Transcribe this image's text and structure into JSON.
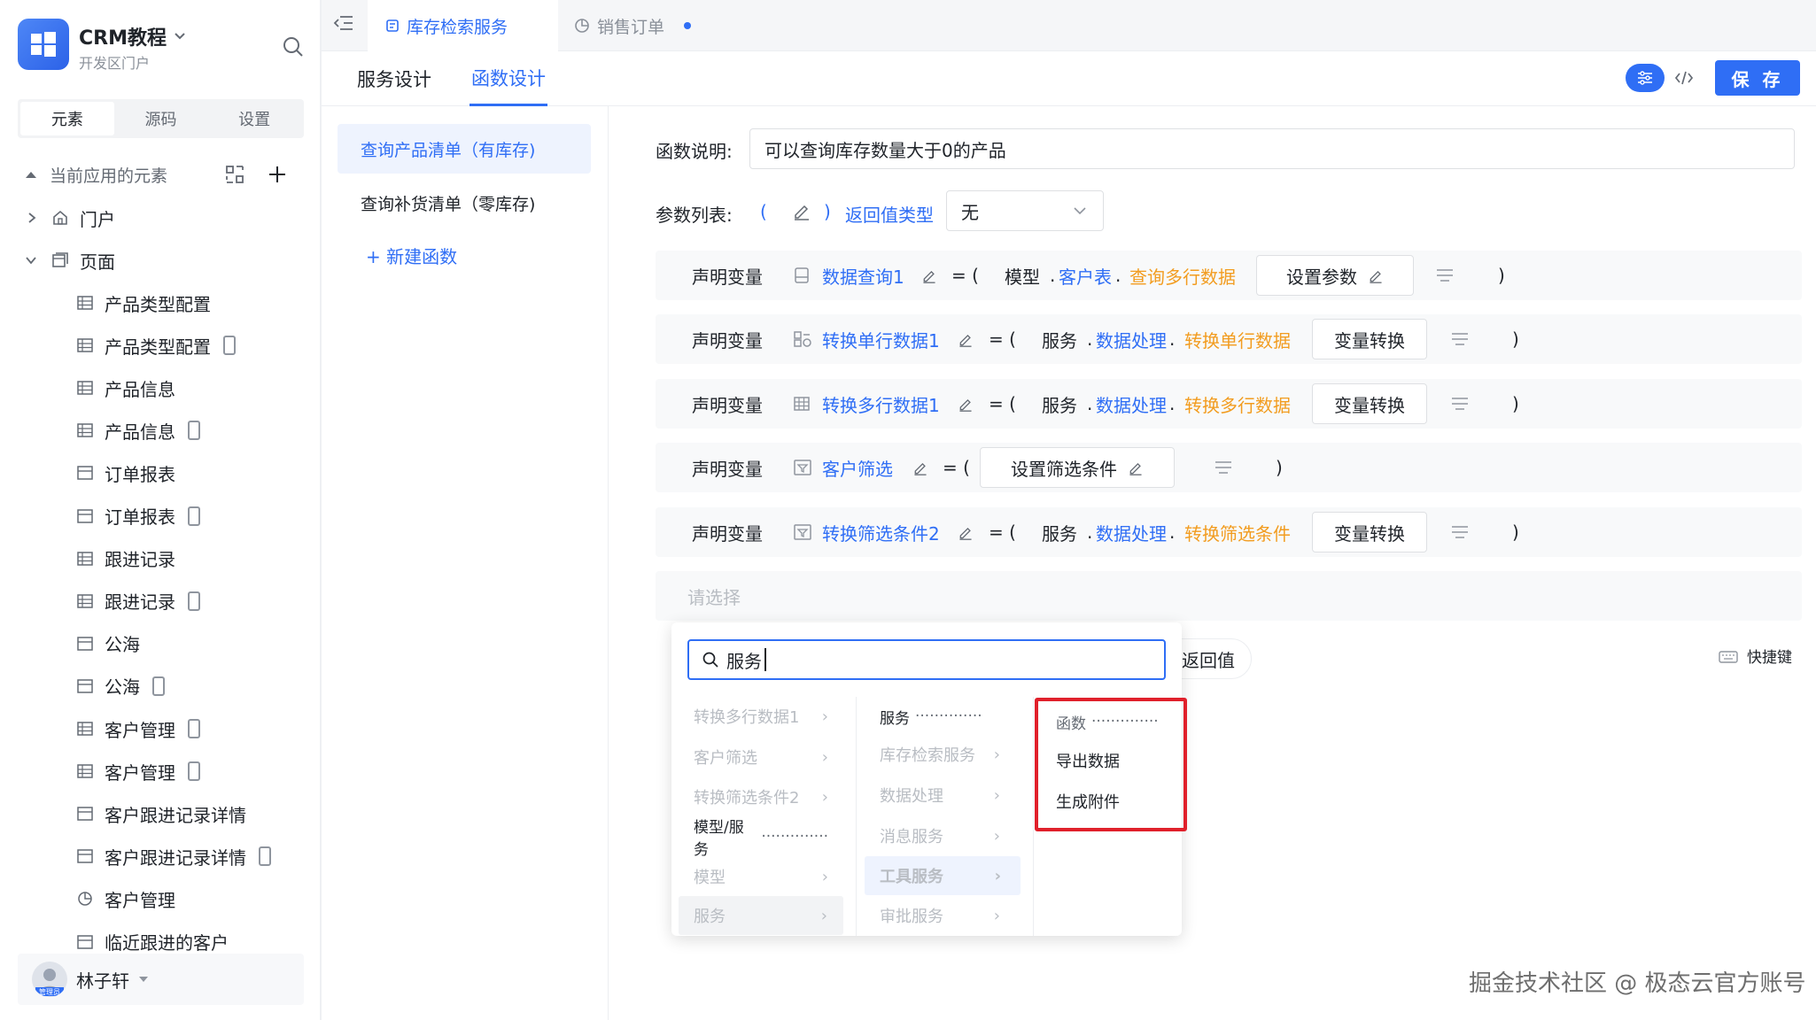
{
  "app": {
    "name": "CRM教程",
    "subtitle": "开发区门户"
  },
  "sidebar": {
    "tabs": [
      "元素",
      "源码",
      "设置"
    ],
    "section_title": "当前应用的元素",
    "nodes": [
      {
        "label": "门户"
      },
      {
        "label": "页面"
      }
    ],
    "pages": [
      {
        "label": "产品类型配置",
        "mobile": false,
        "icon": "table"
      },
      {
        "label": "产品类型配置",
        "mobile": true,
        "icon": "table"
      },
      {
        "label": "产品信息",
        "mobile": false,
        "icon": "table"
      },
      {
        "label": "产品信息",
        "mobile": true,
        "icon": "table"
      },
      {
        "label": "订单报表",
        "mobile": false,
        "icon": "card"
      },
      {
        "label": "订单报表",
        "mobile": true,
        "icon": "card"
      },
      {
        "label": "跟进记录",
        "mobile": false,
        "icon": "table"
      },
      {
        "label": "跟进记录",
        "mobile": true,
        "icon": "table"
      },
      {
        "label": "公海",
        "mobile": false,
        "icon": "card"
      },
      {
        "label": "公海",
        "mobile": true,
        "icon": "card"
      },
      {
        "label": "客户管理",
        "mobile": true,
        "icon": "table"
      },
      {
        "label": "客户管理",
        "mobile": true,
        "icon": "table"
      },
      {
        "label": "客户跟进记录详情",
        "mobile": false,
        "icon": "card"
      },
      {
        "label": "客户跟进记录详情",
        "mobile": true,
        "icon": "card"
      },
      {
        "label": "客户管理",
        "mobile": false,
        "icon": "chart"
      },
      {
        "label": "临近跟进的客户",
        "mobile": false,
        "icon": "card"
      }
    ],
    "user": {
      "name": "林子轩",
      "role": "管理员"
    }
  },
  "tabs": {
    "active": "库存检索服务",
    "second": "销售订单"
  },
  "subtabs": {
    "service_design": "服务设计",
    "function_design": "函数设计"
  },
  "toolbar": {
    "save": "保 存"
  },
  "functions": {
    "items": [
      "查询产品清单（有库存)",
      "查询补货清单（零库存)"
    ],
    "new": "+ 新建函数"
  },
  "form": {
    "desc_label": "函数说明:",
    "desc_value": "可以查询库存数量大于0的产品",
    "params_label": "参数列表:",
    "paren_open": "(",
    "paren_close": ")",
    "return_type_label": "返回值类型",
    "return_type_value": "无"
  },
  "statements": [
    {
      "keyword": "声明变量",
      "var": "数据查询1",
      "eq": "= (",
      "a": "模型",
      "b": "客户表",
      "c": "查询多行数据",
      "btn": "设置参数",
      "close": ")"
    },
    {
      "keyword": "声明变量",
      "var": "转换单行数据1",
      "eq": "= (",
      "a": "服务",
      "b": "数据处理",
      "c": "转换单行数据",
      "btn": "变量转换",
      "close": ")"
    },
    {
      "keyword": "声明变量",
      "var": "转换多行数据1",
      "eq": "= (",
      "a": "服务",
      "b": "数据处理",
      "c": "转换多行数据",
      "btn": "变量转换",
      "close": ")"
    },
    {
      "keyword": "声明变量",
      "var": "客户筛选",
      "eq": "= (",
      "btn": "设置筛选条件",
      "close": ")"
    },
    {
      "keyword": "声明变量",
      "var": "转换筛选条件2",
      "eq": "= (",
      "a": "服务",
      "b": "数据处理",
      "c": "转换筛选条件",
      "btn": "变量转换",
      "close": ")"
    }
  ],
  "dot": ".",
  "placeholder": "请选择",
  "popup": {
    "search_value": "服务",
    "col1": [
      "转换多行数据1",
      "客户筛选",
      "转换筛选条件2",
      "模型/服务",
      "模型",
      "服务"
    ],
    "col2": [
      "服务",
      "库存检索服务",
      "数据处理",
      "消息服务",
      "工具服务",
      "审批服务"
    ],
    "col3": [
      "函数",
      "导出数据",
      "生成附件"
    ],
    "dots": "··············"
  },
  "return_value": "返回值",
  "shortcut": "快捷键",
  "watermark": "掘金技术社区 @ 极态云官方账号",
  "colors": {
    "accent": "#2f6ef5",
    "orange": "#f29c1f",
    "highlight_box": "#e0202b"
  }
}
